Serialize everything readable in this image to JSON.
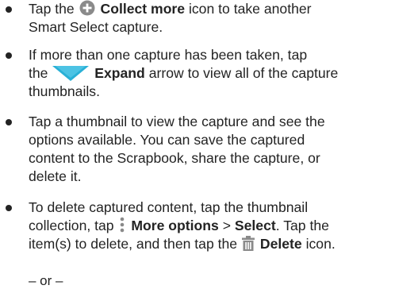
{
  "bullets": [
    {
      "pre": "Tap the",
      "icon": "plus-circle-icon",
      "bold": "Collect more",
      "post_line1": "icon to take another",
      "line2": "Smart Select capture."
    },
    {
      "line1": "If more than one capture has been taken, tap",
      "pre": "the",
      "icon": "chevron-down-icon",
      "bold": "Expand",
      "post": "arrow to view all of the capture",
      "line3": "thumbnails."
    },
    {
      "line1": "Tap a thumbnail to view the capture and see the",
      "line2": "options available. You can save the captured",
      "line3": "content to the Scrapbook, share the capture, or",
      "line4": "delete it."
    },
    {
      "line1": "To delete captured content, tap the thumbnail",
      "pre2": "collection, tap",
      "icon_more": "more-options-icon",
      "bold_more": "More options",
      "sep": ">",
      "bold_select": "Select",
      "post2": ". Tap the",
      "pre3": "item(s) to delete, and then tap the",
      "icon_delete": "trash-icon",
      "bold_delete": "Delete",
      "post3": "icon."
    }
  ],
  "or_text": "– or –",
  "colors": {
    "text": "#232323",
    "icon_gray": "#8a8a8a",
    "expand_teal": "#29b0d6"
  }
}
